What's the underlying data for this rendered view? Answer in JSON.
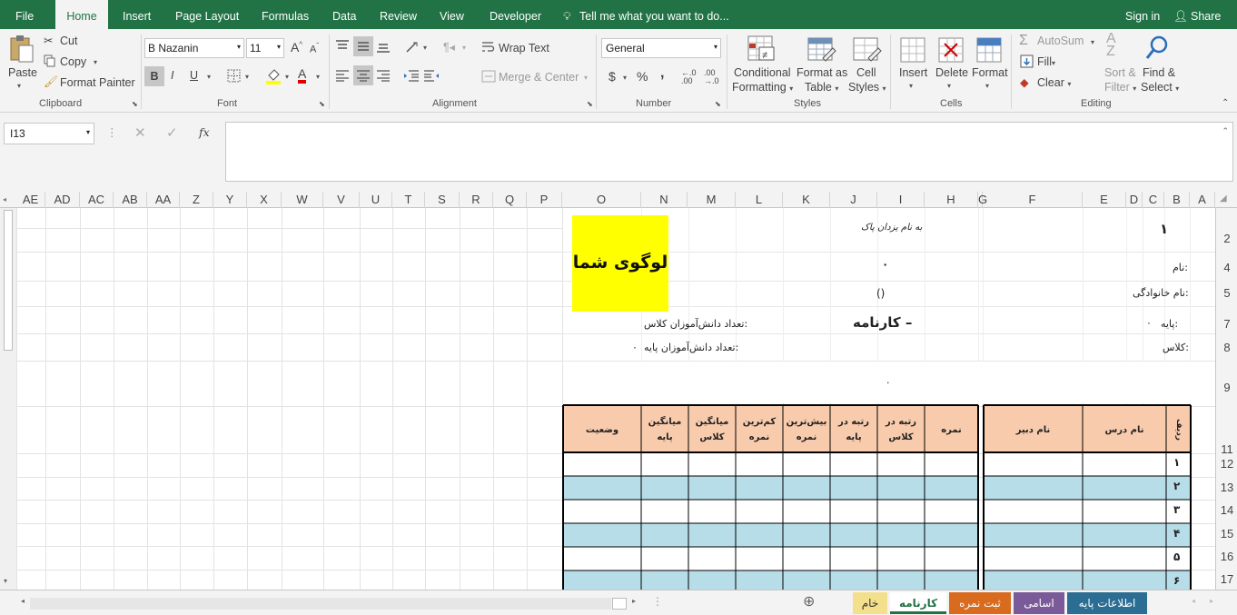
{
  "menu": {
    "file": "File",
    "home": "Home",
    "insert": "Insert",
    "page_layout": "Page Layout",
    "formulas": "Formulas",
    "data": "Data",
    "review": "Review",
    "view": "View",
    "developer": "Developer",
    "tell": "Tell me what you want to do...",
    "signin": "Sign in",
    "share": "Share"
  },
  "clipboard": {
    "paste": "Paste",
    "cut": "Cut",
    "copy": "Copy",
    "format_painter": "Format Painter",
    "label": "Clipboard"
  },
  "font": {
    "name": "B Nazanin",
    "size": "11",
    "bold": "B",
    "italic": "I",
    "underline": "U",
    "label": "Font",
    "grow": "A",
    "shrink": "A",
    "color": "A"
  },
  "alignment": {
    "wrap": "Wrap Text",
    "merge": "Merge & Center",
    "label": "Alignment"
  },
  "number": {
    "format": "General",
    "currency": "$",
    "percent": "%",
    "comma": ",",
    "label": "Number"
  },
  "styles": {
    "conditional": "Conditional",
    "conditional2": "Formatting",
    "format_table": "Format as",
    "format_table2": "Table",
    "cell_styles": "Cell",
    "cell_styles2": "Styles",
    "label": "Styles"
  },
  "cells": {
    "insert": "Insert",
    "delete": "Delete",
    "format": "Format",
    "label": "Cells"
  },
  "editing": {
    "autosum": "AutoSum",
    "fill": "Fill",
    "clear": "Clear",
    "sort": "Sort &",
    "sort2": "Filter",
    "find": "Find &",
    "find2": "Select",
    "label": "Editing"
  },
  "formula": {
    "namebox": "I13",
    "fx": "fx",
    "value": ""
  },
  "columns": [
    "AE",
    "AD",
    "AC",
    "AB",
    "AA",
    "Z",
    "Y",
    "X",
    "W",
    "V",
    "U",
    "T",
    "S",
    "R",
    "Q",
    "P",
    "O",
    "N",
    "M",
    "L",
    "K",
    "J",
    "I",
    "H",
    "G",
    "F",
    "E",
    "D",
    "C",
    "B",
    "A"
  ],
  "rows": [
    "2",
    "4",
    "5",
    "7",
    "8",
    "9",
    "11",
    "12",
    "13",
    "14",
    "15",
    "16",
    "17"
  ],
  "sheet": {
    "num1": "۱",
    "bismillah": "به نام یزدان پاک",
    "logo": "لوگوی شما",
    "name_lbl": "نام:",
    "name_val": "۰",
    "family_lbl": "نام خانوادگی:",
    "family_val": "()",
    "grade_lbl": "پایه:",
    "grade_val": "۰",
    "title": "کارنامه –",
    "class_count": "تعداد دانش‌آموزان کلاس:",
    "class_lbl": "کلاس:",
    "grade_count": "تعداد دانش‌آموزان پایه:",
    "grade_count_val": "۰",
    "dot": ".",
    "headers": {
      "row": "ردیف",
      "course": "نام درس",
      "teacher": "نام دبیر",
      "score": "نمره",
      "rank_class": "رتبه در کلاس",
      "rank_grade": "رتبه در پایه",
      "max": "بیش‌ترین نمره",
      "min": "کم‌ترین نمره",
      "avg_class": "میانگین کلاس",
      "avg_grade": "میانگین پایه",
      "status": "وضعیت"
    },
    "row_nums": [
      "۱",
      "۲",
      "۳",
      "۴",
      "۵",
      "۶"
    ]
  },
  "tabs": {
    "raw": "خام",
    "report": "کارنامه",
    "scores": "ثبت نمره",
    "names": "اسامی",
    "base": "اطلاعات پایه"
  },
  "colors": {
    "accent": "#217346",
    "header_fill": "#f8cbad",
    "stripe": "#b7dde8",
    "logo": "#ffff00"
  }
}
